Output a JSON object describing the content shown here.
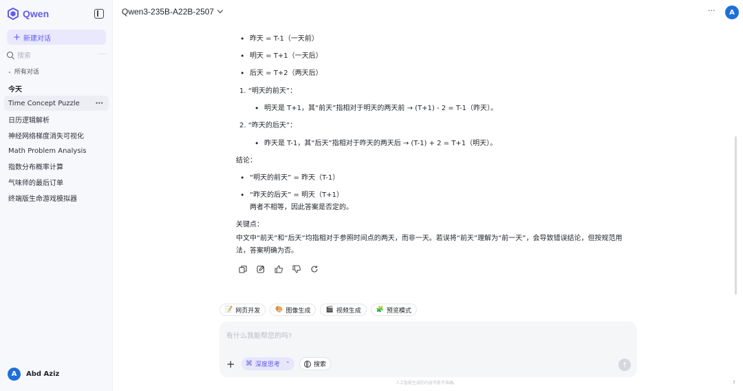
{
  "brand": {
    "name": "Qwen",
    "color": "#615ced"
  },
  "sidebar": {
    "new_chat": "新建对话",
    "search_placeholder": "搜索",
    "all_chats": "所有对话",
    "today_label": "今天",
    "conversations": [
      "Time Concept Puzzle",
      "日历逻辑解析",
      "神经网络梯度消失可视化",
      "Math Problem Analysis",
      "指数分布概率计算",
      "气味师的最后订单",
      "终端版生命游戏模拟器"
    ],
    "more_icon": "···",
    "user": {
      "initial": "A",
      "name": "Abd Aziz"
    }
  },
  "header": {
    "model": "Qwen3-235B-A22B-2507",
    "more": "···",
    "avatar_initial": "A"
  },
  "message": {
    "bullets_top": [
      "昨天 = T-1（一天前）",
      "明天 = T+1（一天后）",
      "后天 = T+2（两天后）"
    ],
    "item1_title": "1.  “明天的前天”：",
    "item1_detail": "明天是 T+1，其“前天”指相对于明天的两天前 → (T+1) - 2 = T-1（昨天）。",
    "item2_title": "2.  “昨天的后天”：",
    "item2_detail": "昨天是 T-1，其“后天”指相对于昨天的两天后 → (T-1) + 2 = T+1（明天）。",
    "conclusion_label": "结论：",
    "conclusion_b1": "“明天的前天” = 昨天（T-1）",
    "conclusion_b2": "“昨天的后天” = 明天（T+1）",
    "conclusion_b2_cont": "两者不相等，因此答案是否定的。",
    "key_label": "关键点：",
    "key_text": "中文中“前天”和“后天”均指相对于参照时间点的两天，而非一天。若误将“前天”理解为“前一天”，会导致错误结论，但按规范用法，答案明确为否。"
  },
  "chips": [
    {
      "icon": "📝",
      "label": "网页开发"
    },
    {
      "icon": "🎨",
      "label": "图像生成"
    },
    {
      "icon": "🎬",
      "label": "视频生成"
    },
    {
      "icon": "🧩",
      "label": "预览模式"
    }
  ],
  "input": {
    "placeholder": "有什么我能帮您的吗?",
    "deep_think": "深度思考",
    "search": "搜索",
    "disclaimer": "人工智能生成的内容可能不准确。"
  },
  "help": "?"
}
